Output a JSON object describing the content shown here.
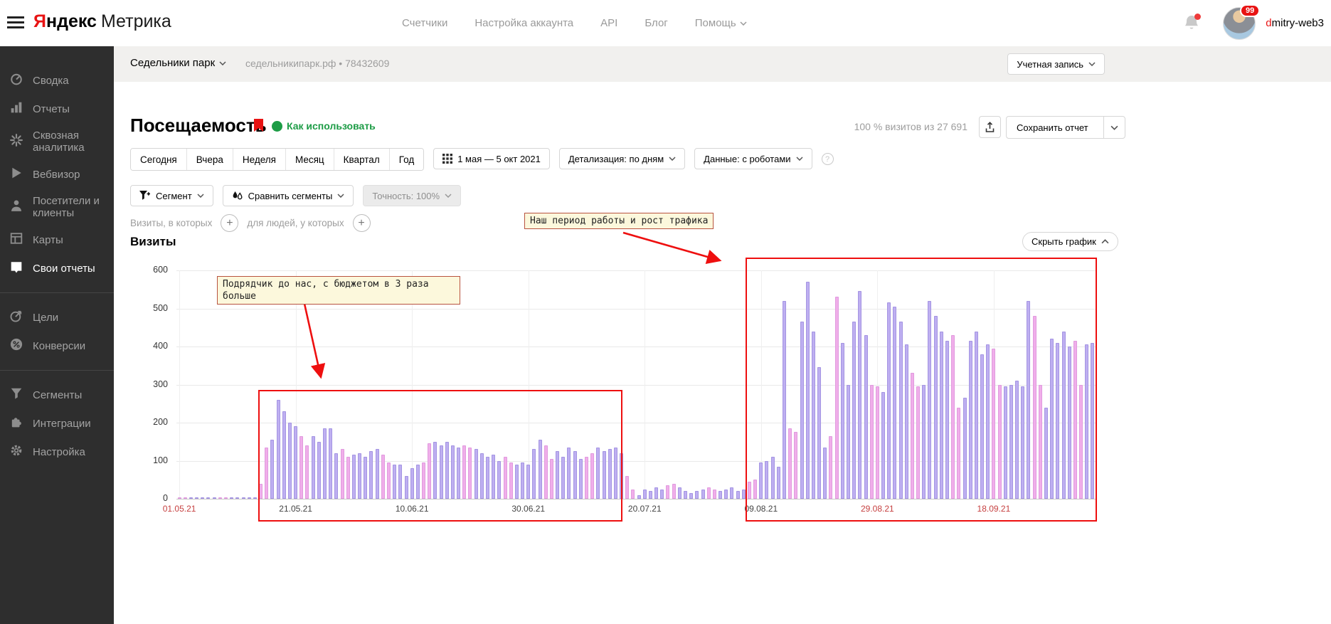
{
  "header": {
    "logo": {
      "brand_first": "Я",
      "brand_rest": "ндекс",
      "product": "Метрика"
    },
    "nav": [
      {
        "label": "Счетчики",
        "chevron": false
      },
      {
        "label": "Настройка аккаунта",
        "chevron": false
      },
      {
        "label": "API",
        "chevron": false
      },
      {
        "label": "Блог",
        "chevron": false
      },
      {
        "label": "Помощь",
        "chevron": true
      }
    ],
    "notifications_badge": "99",
    "user": {
      "first": "d",
      "rest": "mitry-web3"
    }
  },
  "sidebar": {
    "items": [
      {
        "label": "Сводка",
        "icon": "dashboard-icon",
        "active": false
      },
      {
        "label": "Отчеты",
        "icon": "reports-icon",
        "active": false
      },
      {
        "label": "Сквозная аналитика",
        "icon": "cross-analytics-icon",
        "active": false
      },
      {
        "label": "Вебвизор",
        "icon": "webvisor-icon",
        "active": false
      },
      {
        "label": "Посетители и клиенты",
        "icon": "visitors-icon",
        "active": false
      },
      {
        "label": "Карты",
        "icon": "maps-icon",
        "active": false
      },
      {
        "label": "Свои отчеты",
        "icon": "my-reports-icon",
        "active": true
      },
      {
        "divider": true
      },
      {
        "label": "Цели",
        "icon": "goals-icon",
        "active": false
      },
      {
        "label": "Конверсии",
        "icon": "conversions-icon",
        "active": false
      },
      {
        "divider": true
      },
      {
        "label": "Сегменты",
        "icon": "segments-icon",
        "active": false
      },
      {
        "label": "Интеграции",
        "icon": "integrations-icon",
        "active": false
      },
      {
        "label": "Настройка",
        "icon": "settings-icon",
        "active": false
      }
    ]
  },
  "counter_bar": {
    "name": "Седельники парк",
    "domain": "седельникипарк.рф",
    "separator": "•",
    "id": "78432609",
    "account_button": "Учетная запись"
  },
  "report": {
    "title": "Посещаемость",
    "how_to_use": "Как использовать",
    "visits_info": "100 % визитов из 27 691",
    "save_button": "Сохранить отчет",
    "period_tabs": [
      "Сегодня",
      "Вчера",
      "Неделя",
      "Месяц",
      "Квартал",
      "Год"
    ],
    "date_range": "1 мая — 5 окт 2021",
    "detail_dropdown": "Детализация: по дням",
    "data_dropdown": "Данные: с роботами",
    "segment_button": "Сегмент",
    "compare_button": "Сравнить сегменты",
    "accuracy_button": "Точность: 100%",
    "visits_in_which": "Визиты, в которых",
    "for_people": "для людей, у которых",
    "chart_title": "Визиты",
    "hide_chart": "Скрыть график"
  },
  "annotations": {
    "note1": "Подрядчик до нас, с бюджетом в 3 раза больше",
    "note2": "Наш период работы и рост трафика"
  },
  "colors": {
    "accent_red": "#e81313",
    "annotation_red": "#ee0f0f",
    "note_bg": "#fcf8dc",
    "note_border": "#b8533f",
    "green_link": "#1d9c46",
    "sidebar_bg": "#2e2e2e"
  },
  "chart_data": {
    "type": "bar",
    "title": "Визиты",
    "series_name": "Визиты",
    "granularity": "day",
    "start_date": "2021-05-01",
    "end_date": "2021-10-05",
    "ylim": [
      0,
      600
    ],
    "yticks": [
      0,
      100,
      200,
      300,
      400,
      500,
      600
    ],
    "grid": true,
    "x_ticks": [
      {
        "day": 0,
        "label": "01.05.21"
      },
      {
        "day": 20,
        "label": "21.05.21"
      },
      {
        "day": 40,
        "label": "10.06.21"
      },
      {
        "day": 60,
        "label": "30.06.21"
      },
      {
        "day": 80,
        "label": "20.07.21"
      },
      {
        "day": 100,
        "label": "09.08.21"
      },
      {
        "day": 120,
        "label": "29.08.21"
      },
      {
        "day": 140,
        "label": "18.09.21"
      }
    ],
    "bar_colors": {
      "weekday": "#beaff1",
      "weekend": "#f0aeea",
      "weekday_edge": "#a494e2",
      "weekend_edge": "#e09ade"
    },
    "values": [
      0,
      0,
      0,
      0,
      0,
      0,
      0,
      0,
      0,
      0,
      0,
      0,
      0,
      0,
      40,
      135,
      155,
      260,
      230,
      200,
      190,
      165,
      140,
      165,
      150,
      185,
      185,
      120,
      130,
      110,
      115,
      120,
      110,
      125,
      130,
      115,
      95,
      90,
      90,
      60,
      80,
      90,
      95,
      145,
      150,
      140,
      150,
      140,
      135,
      140,
      135,
      130,
      120,
      110,
      115,
      100,
      110,
      95,
      90,
      95,
      90,
      130,
      155,
      140,
      105,
      125,
      110,
      135,
      125,
      105,
      110,
      120,
      135,
      125,
      130,
      135,
      120,
      60,
      25,
      10,
      25,
      20,
      30,
      25,
      35,
      40,
      30,
      20,
      15,
      20,
      25,
      30,
      25,
      20,
      25,
      30,
      20,
      25,
      45,
      50,
      95,
      100,
      110,
      85,
      520,
      185,
      175,
      465,
      570,
      440,
      345,
      135,
      165,
      530,
      410,
      300,
      465,
      545,
      430,
      300,
      295,
      280,
      515,
      505,
      465,
      405,
      330,
      295,
      300,
      520,
      480,
      440,
      415,
      430,
      240,
      265,
      415,
      440,
      380,
      405,
      395,
      300,
      295,
      300,
      310,
      295,
      520,
      480,
      300,
      240,
      420,
      410,
      440,
      400,
      415,
      300,
      405,
      410
    ]
  }
}
